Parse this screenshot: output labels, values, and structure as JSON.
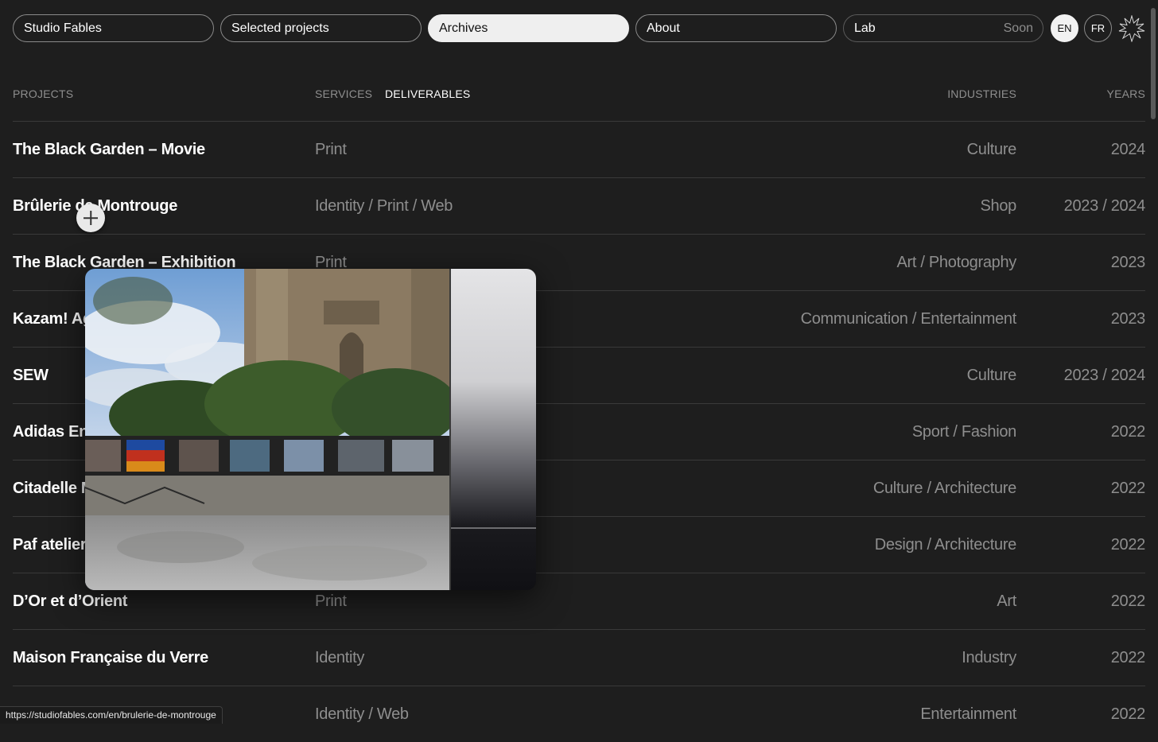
{
  "nav": {
    "studio": "Studio Fables",
    "selected": "Selected projects",
    "archives": "Archives",
    "about": "About",
    "lab": "Lab",
    "lab_badge": "Soon",
    "lang_en": "EN",
    "lang_fr": "FR"
  },
  "header": {
    "projects": "PROJECTS",
    "services": "SERVICES",
    "deliverables": "DELIVERABLES",
    "industries": "INDUSTRIES",
    "years": "YEARS"
  },
  "rows": [
    {
      "name": "The Black Garden – Movie",
      "service": "Print",
      "industry": "Culture",
      "year": "2024"
    },
    {
      "name": "Brûlerie de Montrouge",
      "service": "Identity / Print / Web",
      "industry": "Shop",
      "year": "2023 / 2024"
    },
    {
      "name": "The Black Garden – Exhibition",
      "service": "Print",
      "industry": "Art / Photography",
      "year": "2023"
    },
    {
      "name": "Kazam! Ag",
      "service": "",
      "industry": "Communication / Entertainment",
      "year": "2023"
    },
    {
      "name": "SEW",
      "service": "",
      "industry": "Culture",
      "year": "2023 / 2024"
    },
    {
      "name": "Adidas En",
      "service": "",
      "industry": "Sport / Fashion",
      "year": "2022"
    },
    {
      "name": "Citadelle M",
      "service": "",
      "industry": "Culture / Architecture",
      "year": "2022"
    },
    {
      "name": "Paf atelier",
      "service": "",
      "industry": "Design / Architecture",
      "year": "2022"
    },
    {
      "name": "D’Or et d’Orient",
      "service": "Print",
      "industry": "Art",
      "year": "2022"
    },
    {
      "name": "Maison Française du Verre",
      "service": "Identity",
      "industry": "Industry",
      "year": "2022"
    },
    {
      "name": "",
      "service": "Identity / Web",
      "industry": "Entertainment",
      "year": "2022"
    }
  ],
  "status_url": "https://studiofables.com/en/brulerie-de-montrouge",
  "colors": {
    "background": "#1e1e1e",
    "active_pill": "#efefef",
    "muted_text": "#8e8e8e"
  }
}
